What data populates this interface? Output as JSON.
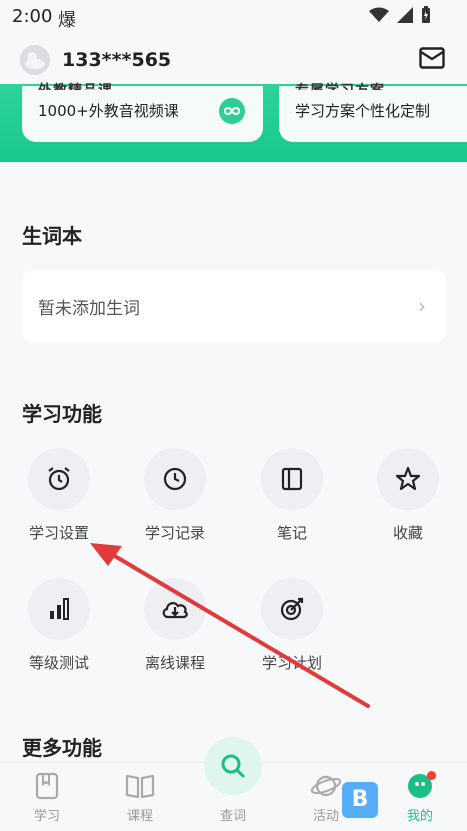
{
  "status_bar": {
    "time": "2:00",
    "notif_glyph": "爆"
  },
  "header": {
    "phone": "133***565"
  },
  "promo_cards": [
    {
      "subtitle": "1000+外教音视频课",
      "cut_title": "外教精品课"
    },
    {
      "subtitle": "学习方案个性化定制",
      "cut_title": "专属学习方案"
    }
  ],
  "vocab": {
    "title": "生词本",
    "empty_text": "暂未添加生词"
  },
  "features": {
    "title": "学习功能",
    "items": [
      {
        "label": "学习设置",
        "icon": "alarm-clock-icon"
      },
      {
        "label": "学习记录",
        "icon": "clock-icon"
      },
      {
        "label": "笔记",
        "icon": "notebook-icon"
      },
      {
        "label": "收藏",
        "icon": "star-icon"
      },
      {
        "label": "等级测试",
        "icon": "bar-chart-icon"
      },
      {
        "label": "离线课程",
        "icon": "cloud-download-icon"
      },
      {
        "label": "学习计划",
        "icon": "target-icon"
      }
    ]
  },
  "more": {
    "title": "更多功能"
  },
  "tabs": [
    {
      "label": "学习"
    },
    {
      "label": "课程"
    },
    {
      "label": "查词"
    },
    {
      "label": "活动"
    },
    {
      "label": "我的"
    }
  ],
  "colors": {
    "accent": "#1bbf86",
    "promo": "#2ed39a",
    "arrow": "#e03a3a"
  }
}
